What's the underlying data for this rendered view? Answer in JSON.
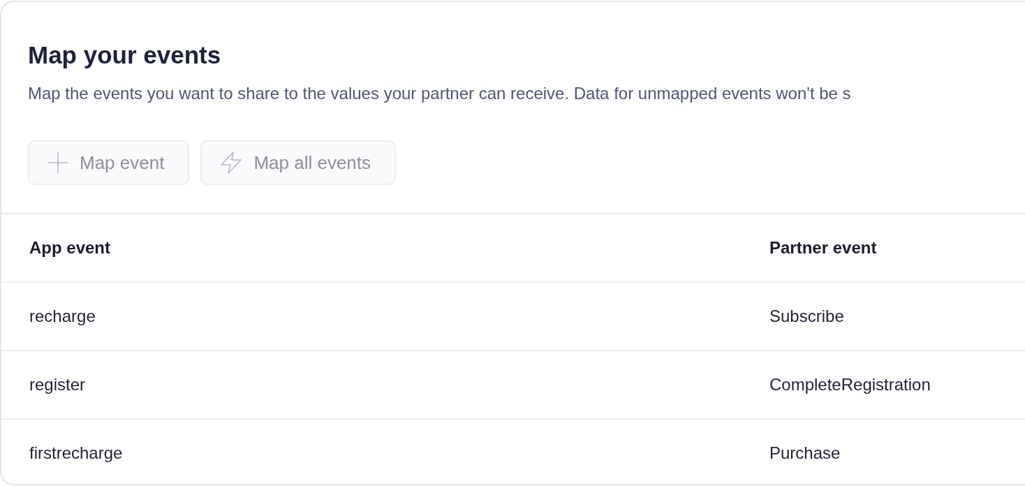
{
  "title": "Map your events",
  "description": "Map the events you want to share to the values your partner can receive. Data for unmapped events won't be s",
  "buttons": [
    {
      "label": "Map event",
      "disabled": true
    },
    {
      "label": "Map all events",
      "disabled": true
    }
  ],
  "table": {
    "columns": [
      "App event",
      "Partner event"
    ],
    "rows": [
      [
        "recharge",
        "Subscribe"
      ],
      [
        "register",
        "CompleteRegistration"
      ],
      [
        "firstrecharge",
        "Purchase"
      ]
    ]
  }
}
